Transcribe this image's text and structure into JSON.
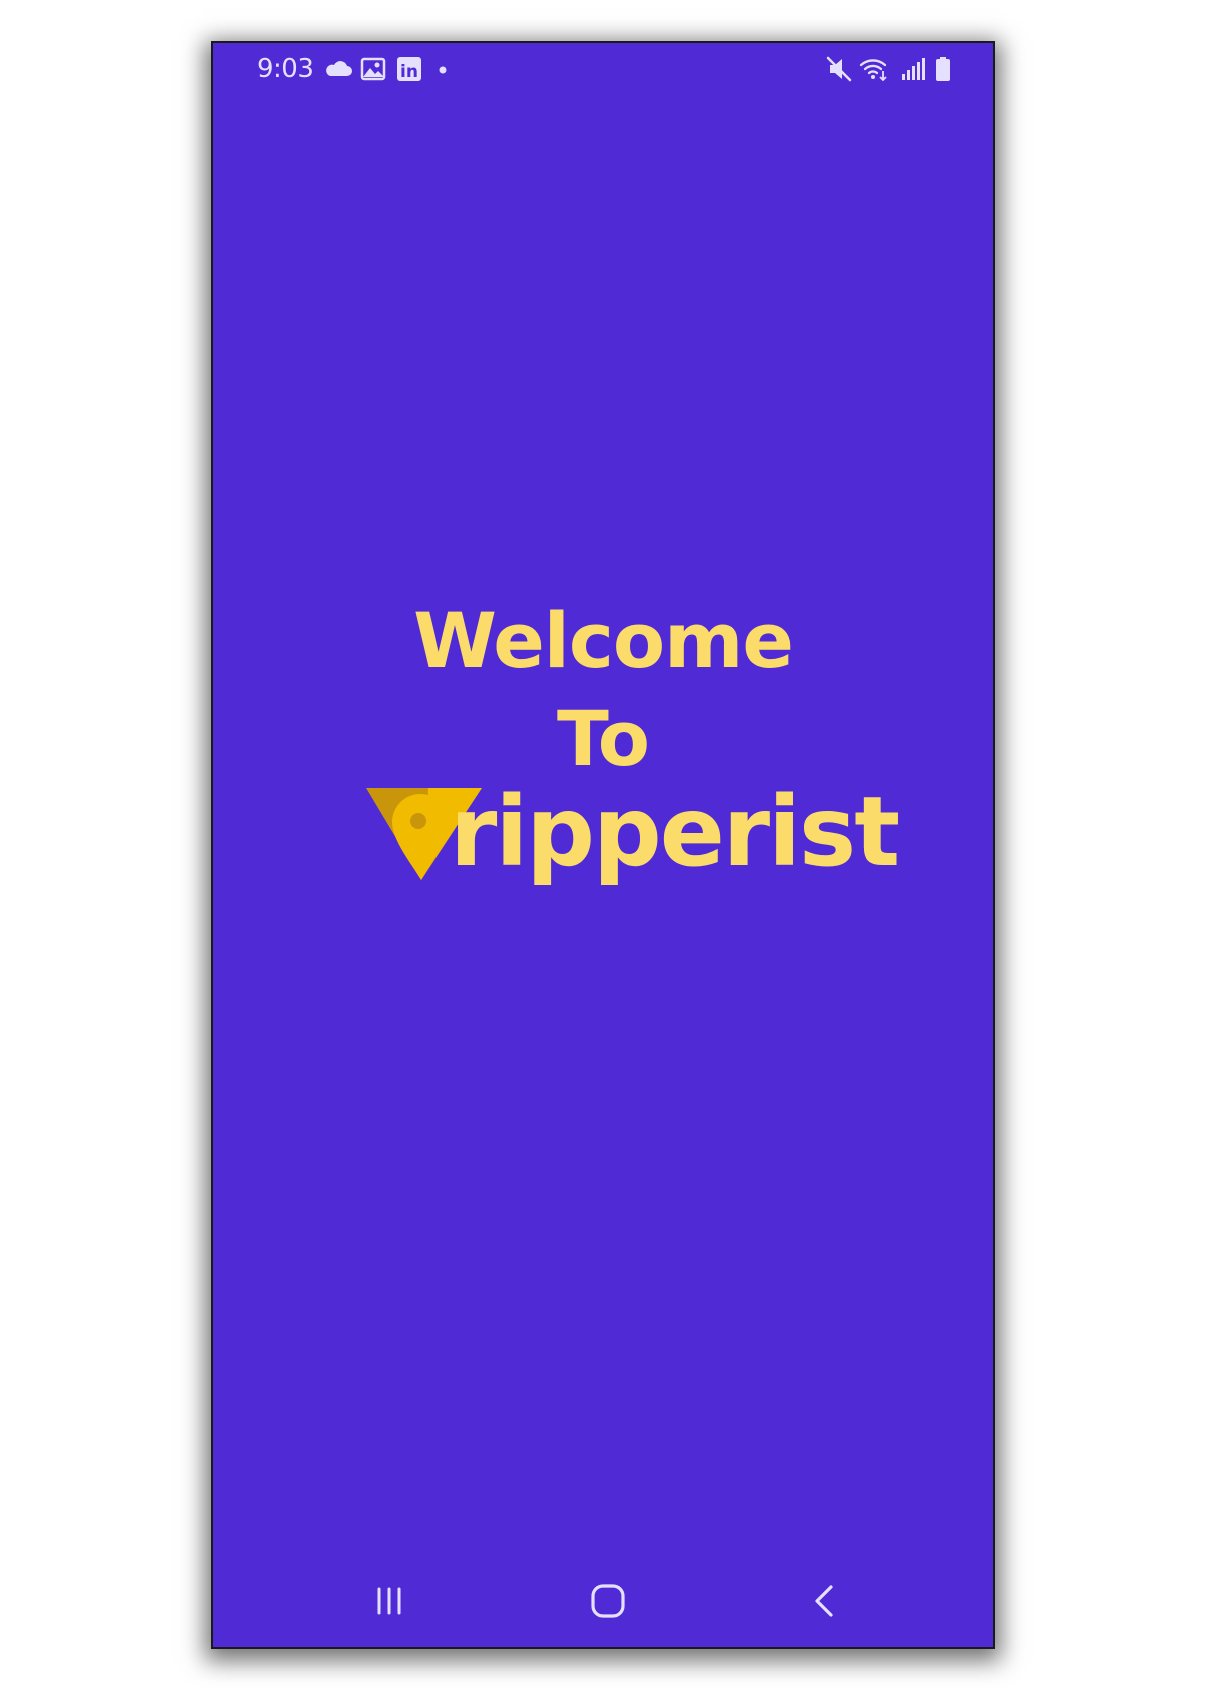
{
  "status_bar": {
    "time": "9:03",
    "left_icons": [
      "cloud-icon",
      "gallery-icon",
      "linkedin-icon",
      "notification-dot-icon"
    ],
    "right_icons": [
      "mute-icon",
      "wifi-icon",
      "signal-icon",
      "battery-icon"
    ],
    "linkedin_glyph": "in"
  },
  "splash": {
    "line1": "Welcome",
    "line2": "To",
    "brand_rest": "ripperist",
    "brand_letter_icon": "location-pin-t-icon"
  },
  "nav_bar": {
    "buttons": [
      "recent-apps-icon",
      "home-icon",
      "back-icon"
    ]
  },
  "colors": {
    "background": "#502bd5",
    "accent_text": "#fbdc6a",
    "pin_light": "#f1bb00",
    "pin_dark": "#c9960b",
    "status_icons": "#e6e0ff"
  }
}
